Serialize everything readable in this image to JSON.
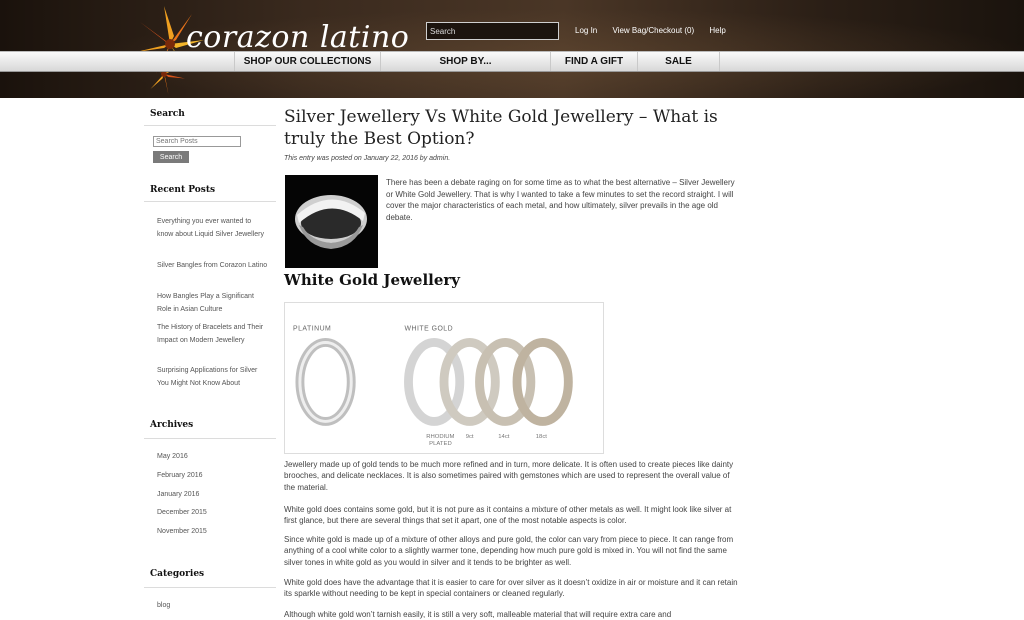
{
  "header": {
    "logo_text": "corazon latino",
    "search_placeholder": "Search",
    "links": [
      "Log In",
      "View Bag/Checkout (0)",
      "Help"
    ]
  },
  "nav": {
    "items": [
      "SHOP OUR COLLECTIONS",
      "SHOP BY...",
      "FIND A GIFT",
      "SALE"
    ]
  },
  "sidebar": {
    "search_heading": "Search",
    "search_placeholder": "Search Posts",
    "search_button": "Search",
    "recent_heading": "Recent Posts",
    "recent_posts": [
      "Everything you ever wanted to know about Liquid Silver Jewellery",
      "Silver Bangles from Corazon Latino",
      "How Bangles Play a Significant Role in Asian Culture",
      "The History of Bracelets and Their Impact on Modern Jewellery",
      "Surprising Applications for Silver You Might Not Know About"
    ],
    "archives_heading": "Archives",
    "archives": [
      "May 2016",
      "February 2016",
      "January 2016",
      "December 2015",
      "November 2015"
    ],
    "categories_heading": "Categories",
    "categories": [
      "blog"
    ]
  },
  "post": {
    "title": "Silver Jewellery Vs White Gold Jewellery – What is truly the Best Option?",
    "meta": "This entry was posted on January 22, 2016 by admin.",
    "intro": "There has been a debate raging on for some time as to what the best alternative – Silver Jewellery or White Gold Jewellery. That is why I wanted to take a few minutes to set the record straight. I will cover the major characteristics of each metal, and how ultimately, silver prevails in the age old debate.",
    "section_heading": "White Gold Jewellery",
    "figure_labels": {
      "platinum": "PLATINUM",
      "white_gold": "WHITE GOLD",
      "rhodium": "RHODIUM",
      "plated": "PLATED",
      "k9": "9ct",
      "k14": "14ct",
      "k18": "18ct"
    },
    "paragraphs": [
      "Jewellery made up of gold tends to be much more refined and in turn, more delicate. It is often used to create pieces like dainty brooches, and delicate necklaces. It is also sometimes paired with gemstones which are used to represent the overall value of the material.",
      "White gold does contains some gold, but it is not pure as it contains a mixture of other metals as well. It might look like silver at first glance, but there are several things that set it apart, one of the most notable aspects is color.",
      "Since white gold is made up of a mixture of other alloys and pure gold, the color can vary from piece to piece. It can range from anything of a cool white color to a slightly warmer tone, depending how much pure gold is mixed in. You will not find the same silver tones in white gold as you would in silver and it tends to be brighter as well.",
      "White gold does have the advantage that it is easier to care for over silver as it doesn’t oxidize in air or moisture and it can retain its sparkle without needing to be kept in special containers or cleaned regularly.",
      "Although white gold won’t tarnish easily, it is still a very soft, malleable material that will require extra care and"
    ]
  }
}
